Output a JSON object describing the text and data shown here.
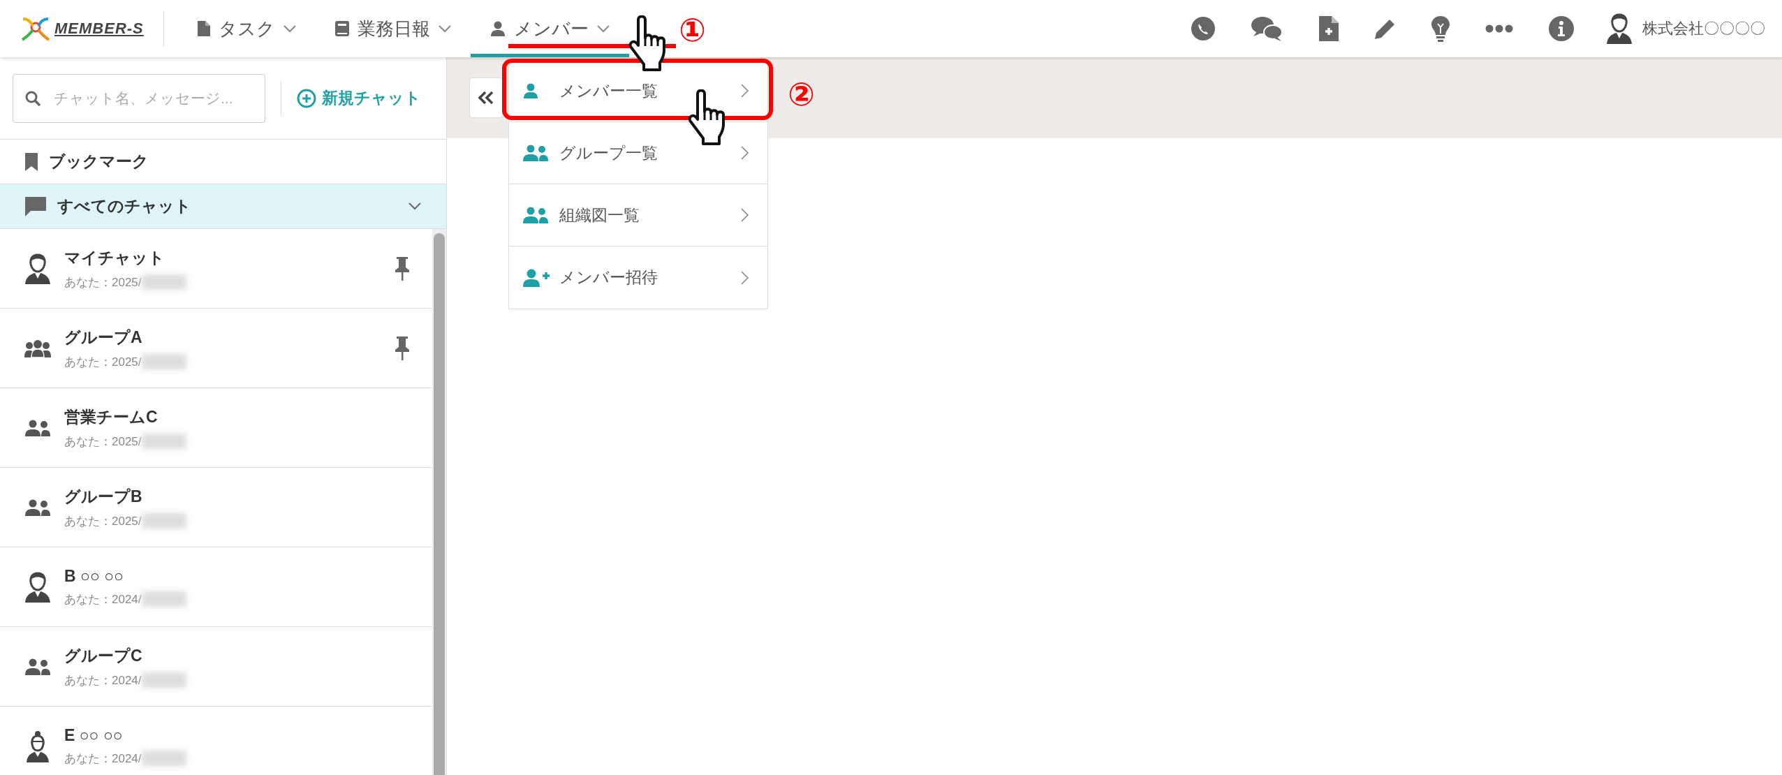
{
  "logo": {
    "text": "MEMBER-S"
  },
  "nav": [
    {
      "label": "タスク",
      "kind": "document",
      "selected": false
    },
    {
      "label": "業務日報",
      "kind": "book",
      "selected": false
    },
    {
      "label": "メンバー",
      "kind": "person",
      "selected": true
    }
  ],
  "user": {
    "name": "株式会社〇〇〇〇"
  },
  "sidebar": {
    "search": {
      "placeholder": "チャット名、メッセージ..."
    },
    "new_chat": "新規チャット",
    "bookmark": "ブックマーク",
    "all_chats": {
      "label": "すべてのチャット",
      "expanded": true
    },
    "chats": [
      {
        "name": "マイチャット",
        "kind": "person",
        "preview": "あなた：2025/",
        "pinned": true
      },
      {
        "name": "グループA",
        "kind": "crowd",
        "preview": "あなた：2025/",
        "pinned": true
      },
      {
        "name": "営業チームC",
        "kind": "group",
        "preview": "あなた：2025/",
        "pinned": false
      },
      {
        "name": "グループB",
        "kind": "group",
        "preview": "あなた：2025/",
        "pinned": false
      },
      {
        "name": "B ○○ ○○",
        "kind": "person",
        "preview": "あなた：2024/",
        "pinned": false
      },
      {
        "name": "グループC",
        "kind": "group",
        "preview": "あなた：2024/",
        "pinned": false
      },
      {
        "name": "E ○○ ○○",
        "kind": "woman",
        "preview": "あなた：2024/",
        "pinned": false
      }
    ]
  },
  "member_menu": [
    {
      "label": "メンバー一覧",
      "kind": "person",
      "highlighted": true
    },
    {
      "label": "グループ一覧",
      "kind": "group",
      "highlighted": false
    },
    {
      "label": "組織図一覧",
      "kind": "group",
      "highlighted": false
    },
    {
      "label": "メンバー招待",
      "kind": "person-add",
      "highlighted": false
    }
  ],
  "annotations": [
    "①",
    "②"
  ]
}
